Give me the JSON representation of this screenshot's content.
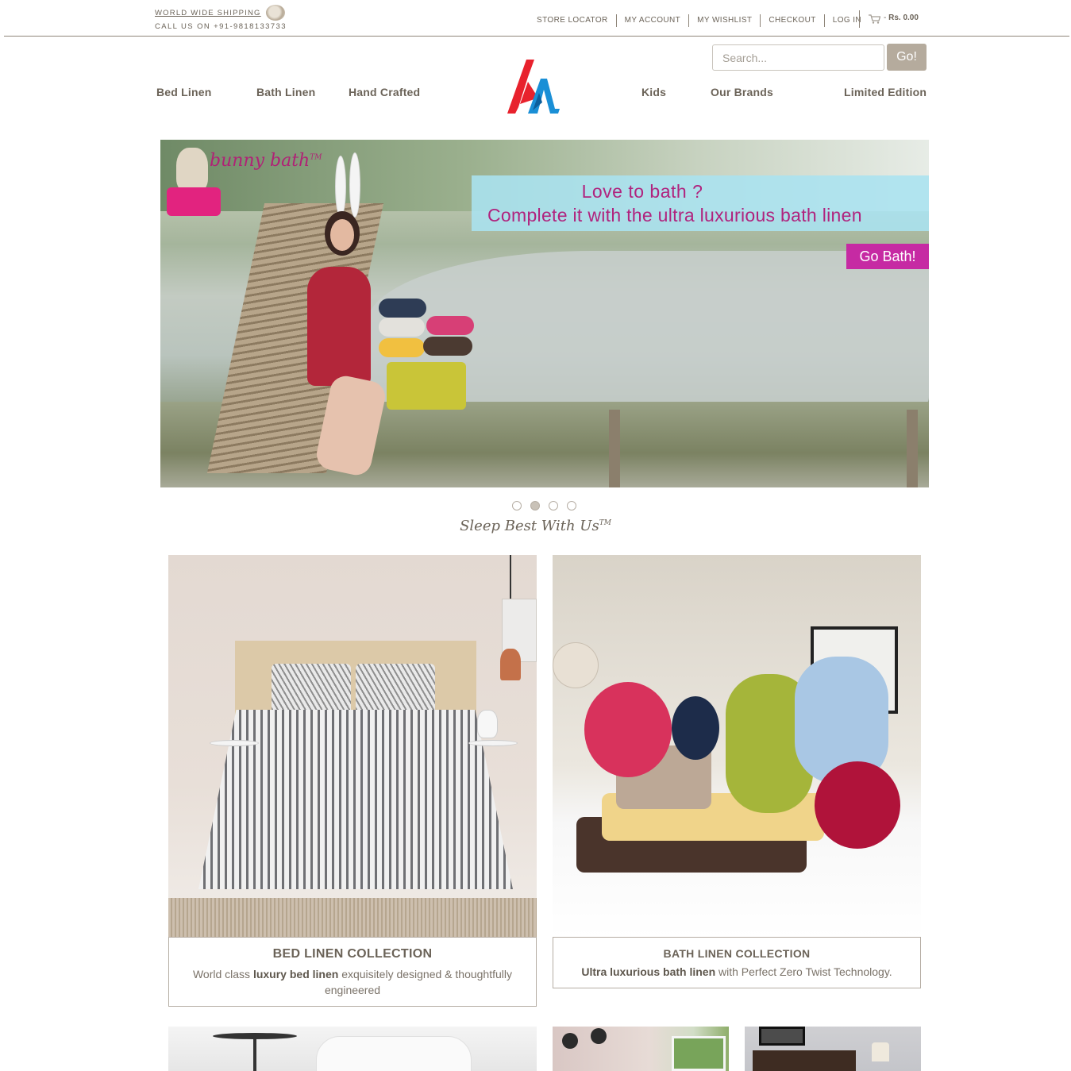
{
  "topbar": {
    "shipping": "WORLD WIDE SHIPPING",
    "call": "CALL US ON +91-9818133733",
    "links": [
      "STORE LOCATOR",
      "MY ACCOUNT",
      "MY WISHLIST",
      "CHECKOUT",
      "LOG IN"
    ],
    "cart_amount": "Rs. 0.00"
  },
  "header": {
    "search_placeholder": "Search...",
    "go_label": "Go!",
    "nav_left": [
      "Bed Linen",
      "Bath Linen",
      "Hand Crafted"
    ],
    "nav_right": [
      "Kids",
      "Our Brands",
      "Limited Edition"
    ],
    "logo_colors": {
      "red": "#e8222d",
      "blue": "#1a8fd6"
    }
  },
  "hero": {
    "brand": "bunny bath",
    "brand_mark": "TM",
    "headline_1": "Love to  bath ?",
    "headline_2": "Complete it with the ultra luxurious bath linen",
    "cta": "Go Bath!",
    "slides": 4,
    "active_slide": 2
  },
  "tagline": {
    "text": "Sleep Best With Us",
    "mark": "TM"
  },
  "collections": [
    {
      "title": "BED LINEN COLLECTION",
      "desc_pre": "World class ",
      "desc_bold": "luxury bed linen",
      "desc_post": " exquisitely designed & thoughtfully engineered"
    },
    {
      "title": "BATH LINEN COLLECTION",
      "desc_pre": "",
      "desc_bold": "Ultra luxurious bath linen",
      "desc_post": " with Perfect Zero Twist Technology."
    }
  ],
  "colors": {
    "text": "#6b6358",
    "accent_button": "#b5ab9d",
    "promo_magenta": "#b0237e",
    "cta_magenta": "#c62aa3"
  }
}
